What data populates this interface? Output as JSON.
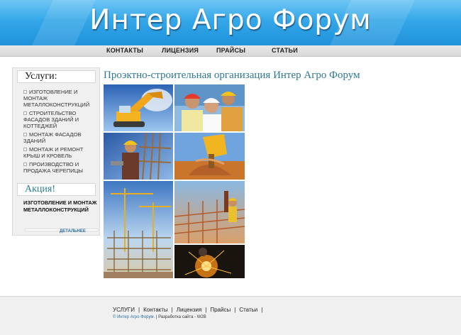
{
  "header": {
    "logo_text": "Интер Агро Форум"
  },
  "nav": {
    "items": [
      "КОНТАКТЫ",
      "ЛИЦЕНЗИЯ",
      "ПРАЙСЫ",
      "СТАТЬИ"
    ]
  },
  "sidebar": {
    "services_title": "Услуги:",
    "services": [
      "Изготовление и монтаж металлоконструкций",
      "Строительство фасадов зданий и коттеджей",
      "Монтаж фасадов зданий",
      "Монтаж и ремонт крыш и кровель",
      "Производство и продажа черепицы"
    ],
    "promo_title": "Акция!",
    "promo_text": "ИЗГОТОВЛЕНИЕ И МОНТАЖ МЕТАЛЛОКОНСТРУКЦИЙ",
    "promo_link": "ДЕТАЛЬНЕЕ"
  },
  "main": {
    "title": "Проэктно-строительная организация Интер Агро Форум"
  },
  "footer": {
    "links": [
      "УСЛУГИ",
      "Контакты",
      "Лицензия",
      "Прайсы",
      "Статьи"
    ],
    "separator": "|",
    "copyright_symbol": "©",
    "copyright_brand": "Интер Агро Форум.",
    "dev_text": "| Разработка сайта - W2B"
  },
  "colors": {
    "header_top": "#6fc6f4",
    "header_bottom": "#1f92db",
    "title_teal": "#2f7790",
    "link_blue": "#2a6fa3"
  }
}
